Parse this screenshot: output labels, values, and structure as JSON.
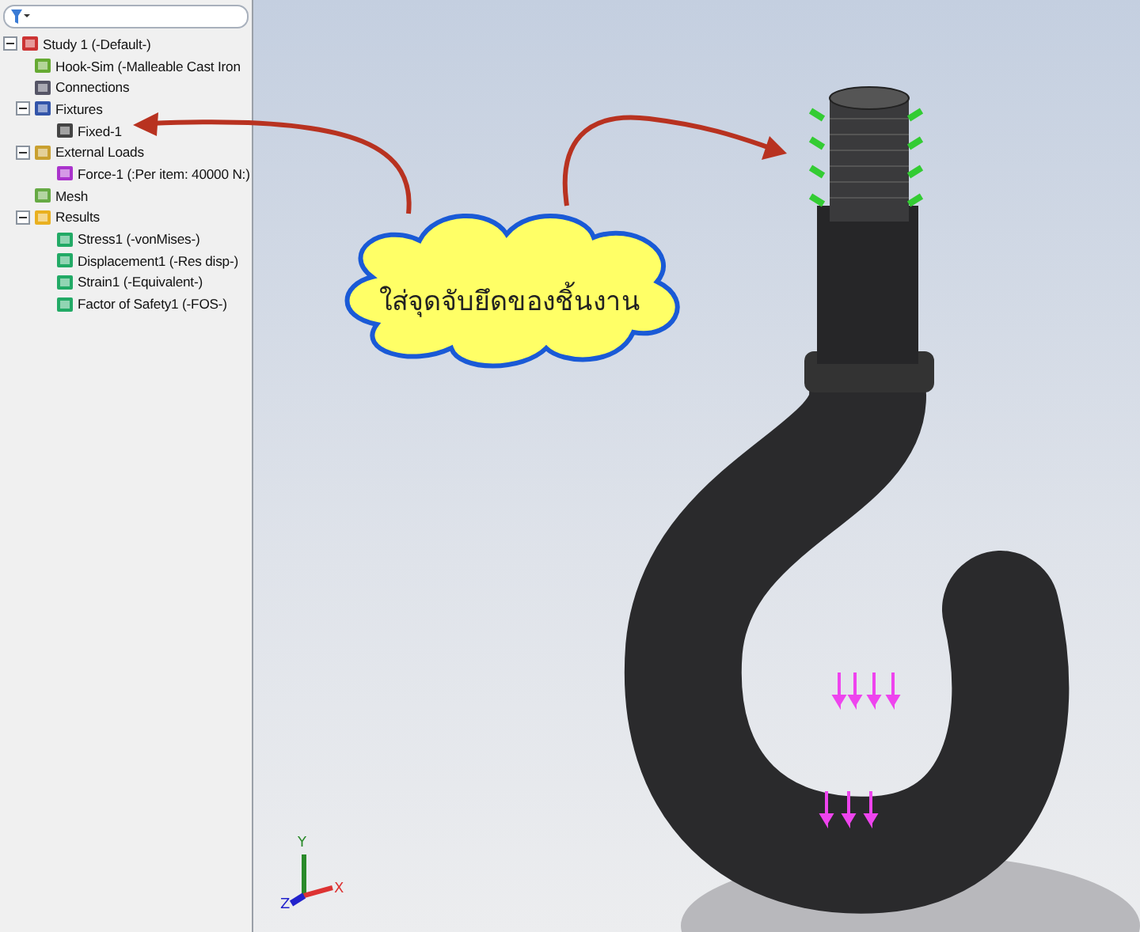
{
  "tree": [
    {
      "label": "Study 1 (-Default-)",
      "kind": "study",
      "expanded": true,
      "children": [
        {
          "label": "Hook-Sim (-Malleable Cast Iron",
          "kind": "part"
        },
        {
          "label": "Connections",
          "kind": "connections"
        },
        {
          "label": "Fixtures",
          "kind": "fixtures",
          "expanded": true,
          "children": [
            {
              "label": "Fixed-1",
              "kind": "fixed"
            }
          ]
        },
        {
          "label": "External Loads",
          "kind": "loads",
          "expanded": true,
          "children": [
            {
              "label": "Force-1 (:Per item: 40000 N:)",
              "kind": "force"
            }
          ]
        },
        {
          "label": "Mesh",
          "kind": "mesh"
        },
        {
          "label": "Results",
          "kind": "results",
          "expanded": true,
          "children": [
            {
              "label": "Stress1 (-vonMises-)",
              "kind": "plot"
            },
            {
              "label": "Displacement1 (-Res disp-)",
              "kind": "plot"
            },
            {
              "label": "Strain1 (-Equivalent-)",
              "kind": "plot"
            },
            {
              "label": "Factor of Safety1 (-FOS-)",
              "kind": "plot"
            }
          ]
        }
      ]
    }
  ],
  "callout": {
    "text": "ใส่จุดจับยึดของชิ้นงาน"
  },
  "triad": {
    "x": "X",
    "y": "Y",
    "z": "Z"
  }
}
